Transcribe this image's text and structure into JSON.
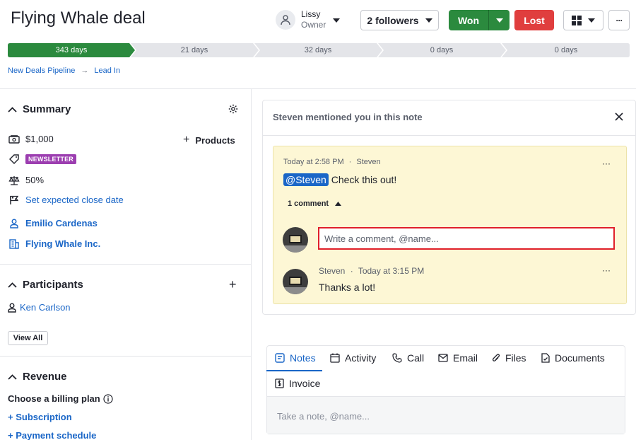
{
  "header": {
    "title": "Flying Whale deal",
    "owner_name": "Lissy",
    "owner_role": "Owner",
    "followers_label": "2 followers",
    "won_label": "Won",
    "lost_label": "Lost"
  },
  "pipeline": {
    "stages": [
      {
        "label": "343 days",
        "active": true
      },
      {
        "label": "21 days",
        "active": false
      },
      {
        "label": "32 days",
        "active": false
      },
      {
        "label": "0 days",
        "active": false
      },
      {
        "label": "0 days",
        "active": false
      }
    ],
    "colors": {
      "active": "#2b8a3e",
      "inactive": "#e4e5e9"
    }
  },
  "breadcrumb": {
    "pipeline": "New Deals Pipeline",
    "arrow": "→",
    "stage": "Lead In"
  },
  "summary": {
    "title": "Summary",
    "value": "$1,000",
    "products_label": "Products",
    "label_badge": "NEWSLETTER",
    "probability": "50%",
    "close_date_link": "Set expected close date",
    "person": "Emilio Cardenas",
    "organization": "Flying Whale Inc."
  },
  "participants": {
    "title": "Participants",
    "items": [
      "Ken Carlson"
    ],
    "view_all_label": "View All"
  },
  "revenue": {
    "title": "Revenue",
    "billing_label": "Choose a billing plan",
    "subscription_link": "+ Subscription",
    "payment_link": "+ Payment schedule"
  },
  "mention_card": {
    "title": "Steven mentioned you in this note",
    "note_time": "Today at 2:58 PM",
    "note_sep": "·",
    "note_author": "Steven",
    "mention": "@Steven",
    "note_text": "Check this out!",
    "comments_label": "1 comment",
    "comment_placeholder": "Write a comment, @name...",
    "comment": {
      "author": "Steven",
      "sep": "·",
      "time": "Today at 3:15 PM",
      "text": "Thanks a lot!"
    },
    "more_label": "···"
  },
  "tabs": {
    "items": [
      "Notes",
      "Activity",
      "Call",
      "Email",
      "Files",
      "Documents",
      "Invoice"
    ],
    "active": "Notes",
    "note_placeholder": "Take a note, @name..."
  },
  "colors": {
    "accent": "#1a66c7",
    "won": "#2b8a3e",
    "lost": "#e03e3e",
    "highlight": "#e0202a",
    "note_bg": "#fdf7d5"
  }
}
